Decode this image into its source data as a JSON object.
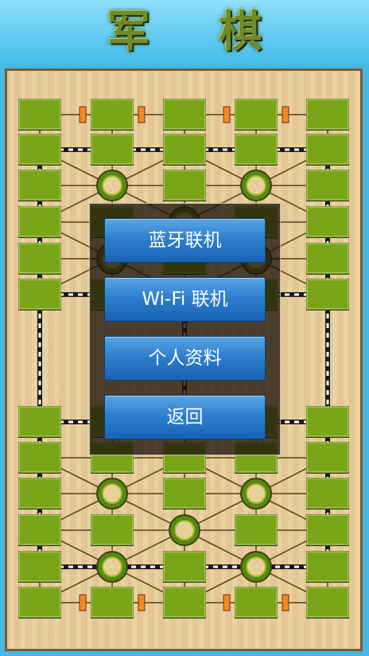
{
  "app": {
    "title": "军 棋"
  },
  "menu": {
    "buttons": [
      {
        "label": "蓝牙联机"
      },
      {
        "label": "Wi-Fi 联机"
      },
      {
        "label": "个人资料"
      },
      {
        "label": "返回"
      }
    ]
  },
  "colors": {
    "sky": "#56c7ee",
    "board": "#e9cf9c",
    "post": "#7aa518",
    "camp_ring": "#8cbf24",
    "headquarter_marker": "#f08a24",
    "button": "#2f7fcf"
  },
  "icons": {
    "post": "green-square-tile",
    "camp": "green-ring",
    "headquarters": "orange-marker"
  }
}
